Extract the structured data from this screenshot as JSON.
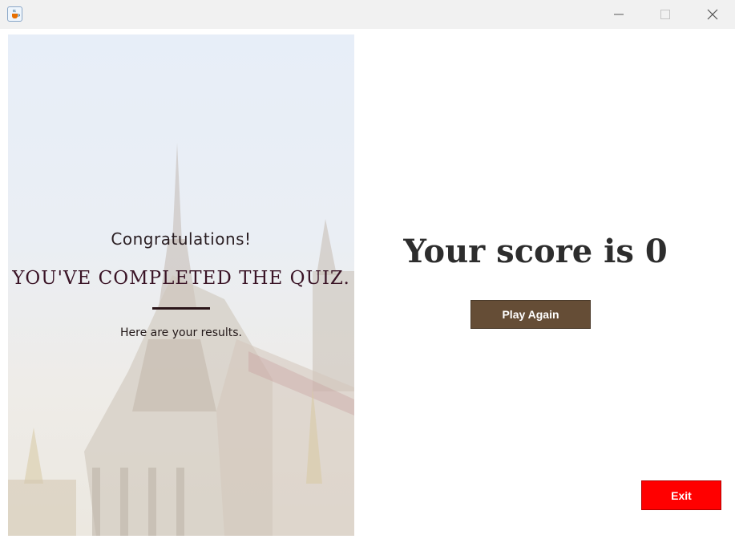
{
  "window": {
    "app_icon": "java-cup-icon",
    "controls": [
      "minimize-icon",
      "maximize-icon",
      "close-icon"
    ]
  },
  "left_panel": {
    "congrats": "Congratulations!",
    "completed": "YOU'VE COMPLETED THE QUIZ.",
    "results": "Here are your results."
  },
  "main": {
    "score_text": "Your score is 0",
    "play_again_label": "Play Again",
    "exit_label": "Exit"
  },
  "colors": {
    "play_again_bg": "#654d36",
    "exit_bg": "#ff0000"
  }
}
